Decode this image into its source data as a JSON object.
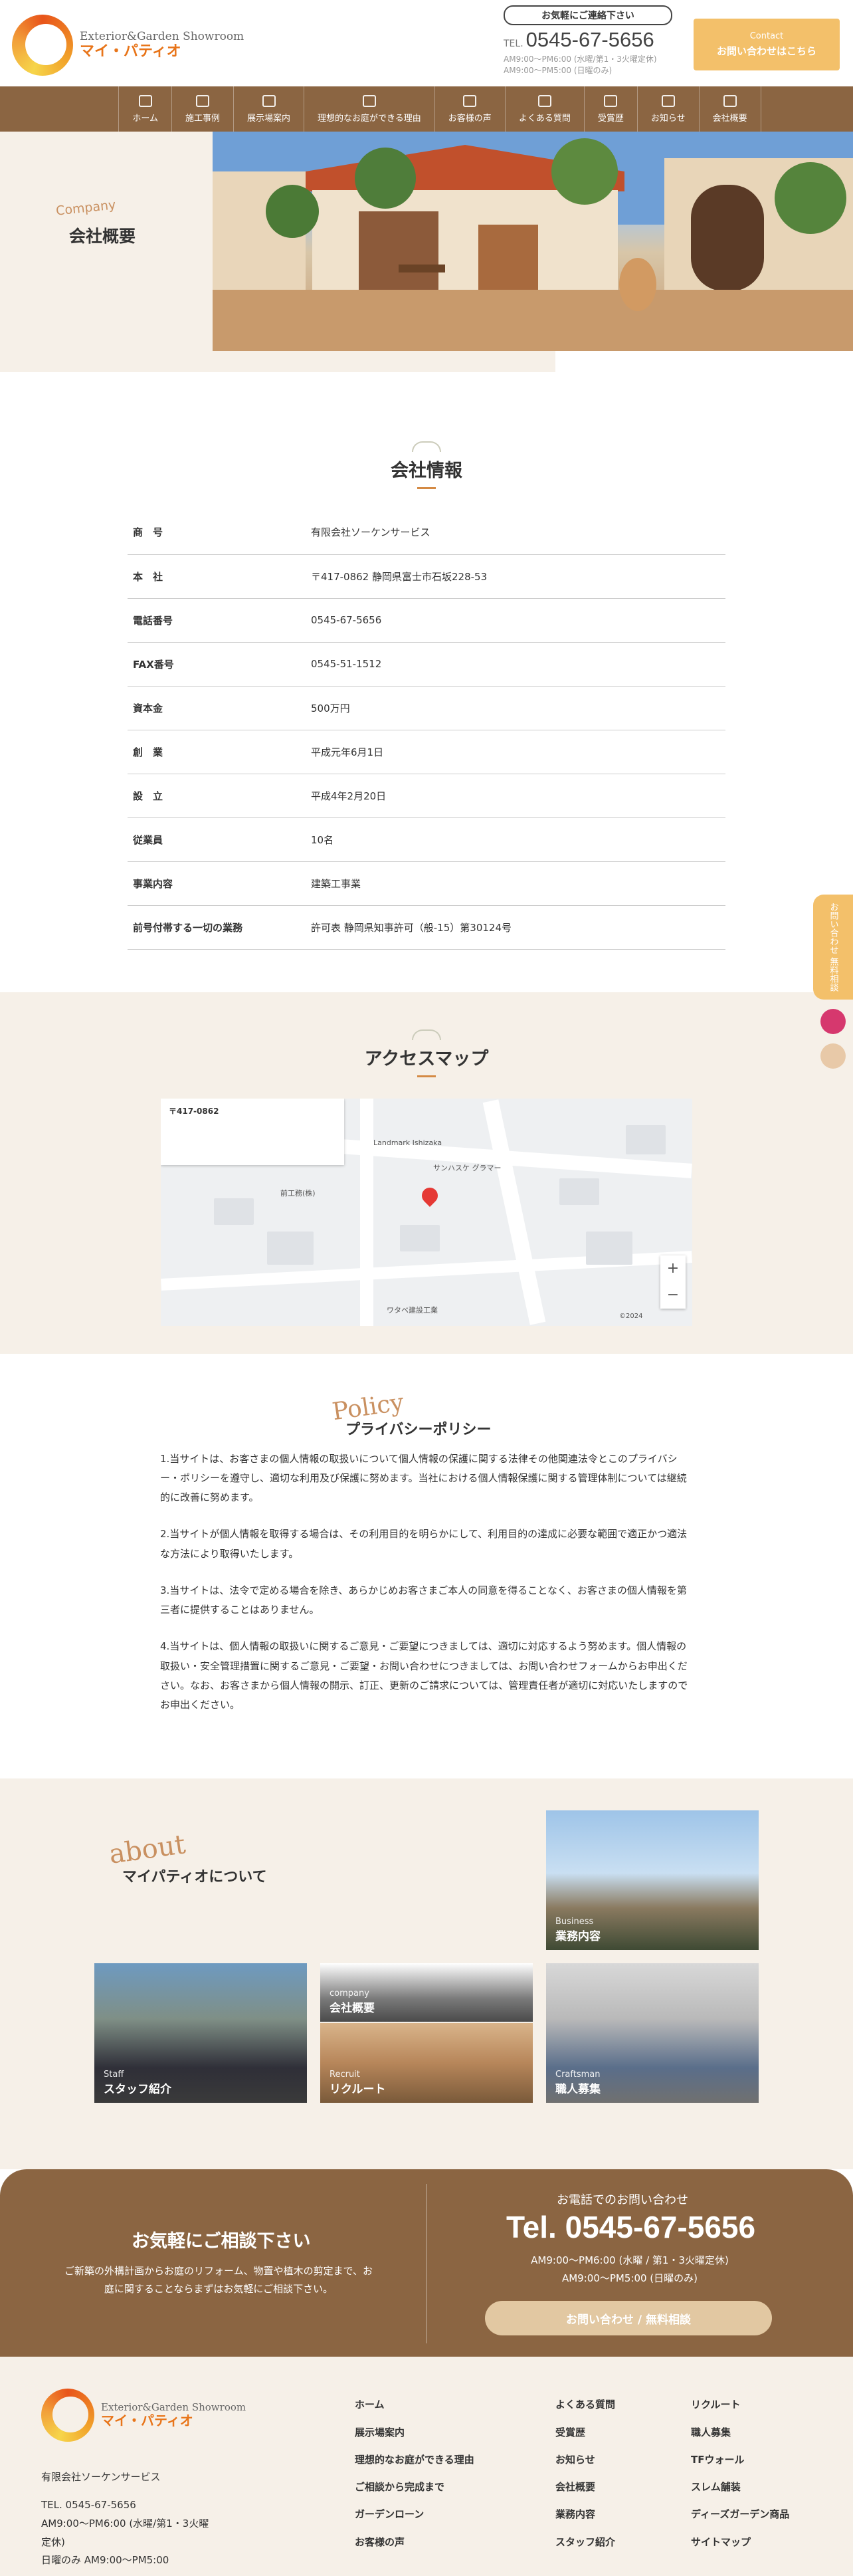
{
  "header": {
    "logo_en": "Exterior&Garden Showroom",
    "logo_ja": "マイ・パティオ",
    "pill": "お気軽にご連絡下さい",
    "tel_label": "TEL.",
    "tel": "0545-67-5656",
    "hours_1": "AM9:00〜PM6:00 (水曜/第1・3火曜定休)",
    "hours_2": "AM9:00〜PM5:00 (日曜のみ)",
    "contact_small": "Contact",
    "contact_main": "お問い合わせはこちら"
  },
  "nav": [
    "ホーム",
    "施工事例",
    "展示場案内",
    "理想的なお庭ができる理由",
    "お客様の声",
    "よくある質問",
    "受賞歴",
    "お知らせ",
    "会社概要"
  ],
  "hero": {
    "title_en": "Company",
    "title": "会社概要"
  },
  "company": {
    "title": "会社情報",
    "rows": [
      {
        "k": "商　号",
        "v": "有限会社ソーケンサービス"
      },
      {
        "k": "本　社",
        "v": "〒417-0862 静岡県富士市石坂228-53"
      },
      {
        "k": "電話番号",
        "v": "0545-67-5656"
      },
      {
        "k": "FAX番号",
        "v": "0545-51-1512"
      },
      {
        "k": "資本金",
        "v": "500万円"
      },
      {
        "k": "創　業",
        "v": "平成元年6月1日"
      },
      {
        "k": "設　立",
        "v": "平成4年2月20日"
      },
      {
        "k": "従業員",
        "v": "10名"
      },
      {
        "k": "事業内容",
        "v": "建築工事業"
      },
      {
        "k": "前号付帯する一切の業務",
        "v": "許可表 静岡県知事許可（般-15）第30124号"
      }
    ]
  },
  "access": {
    "title": "アクセスマップ",
    "card_title": "〒417-0862",
    "map_labels": [
      "Landmark Ishizaka",
      "サンハスケ グラマー",
      "ワタベ建設工業",
      "前工務(株)",
      "©2024"
    ]
  },
  "policy": {
    "title_en": "Policy",
    "title": "プライバシーポリシー",
    "paragraphs": [
      "1.当サイトは、お客さまの個人情報の取扱いについて個人情報の保護に関する法律その他関連法令とこのプライバシー・ポリシーを遵守し、適切な利用及び保護に努めます。当社における個人情報保護に関する管理体制については継続的に改善に努めます。",
      "2.当サイトが個人情報を取得する場合は、その利用目的を明らかにして、利用目的の達成に必要な範囲で適正かつ適法な方法により取得いたします。",
      "3.当サイトは、法令で定める場合を除き、あらかじめお客さまご本人の同意を得ることなく、お客さまの個人情報を第三者に提供することはありません。",
      "4.当サイトは、個人情報の取扱いに関するご意見・ご要望につきましては、適切に対応するよう努めます。個人情報の取扱い・安全管理措置に関するご意見・ご要望・お問い合わせにつきましては、お問い合わせフォームからお申出ください。なお、お客さまから個人情報の開示、訂正、更新のご請求については、管理責任者が適切に対応いたしますのでお申出ください。"
    ]
  },
  "about": {
    "title_en": "about",
    "title": "マイパティオについて",
    "tiles": [
      {
        "en": "company",
        "ja": "会社概要"
      },
      {
        "en": "Business",
        "ja": "業務内容"
      },
      {
        "en": "Staff",
        "ja": "スタッフ紹介"
      },
      {
        "en": "Recruit",
        "ja": "リクルート"
      },
      {
        "en": "Craftsman",
        "ja": "職人募集"
      }
    ]
  },
  "cta": {
    "left_title": "お気軽にご相談下さい",
    "left_text": "ご新築の外構計画からお庭のリフォーム、物置や植木の剪定まで、お庭に関することならまずはお気軽にご相談下さい。",
    "right_label": "お電話でのお問い合わせ",
    "tel": "Tel. 0545-67-5656",
    "hours_1": "AM9:00〜PM6:00 (水曜 / 第1・3火曜定休)",
    "hours_2": "AM9:00〜PM5:00 (日曜のみ)",
    "button": "お問い合わせ / 無料相談"
  },
  "footer": {
    "company": "有限会社ソーケンサービス",
    "tel": "TEL. 0545-67-5656",
    "hours_1": "AM9:00〜PM6:00 (水曜/第1・3火曜定休)",
    "hours_2": "日曜のみ AM9:00〜PM5:00",
    "col1": [
      "ホーム",
      "展示場案内",
      "理想的なお庭ができる理由",
      "ご相談から完成まで",
      "ガーデンローン",
      "お客様の声"
    ],
    "col2": [
      "よくある質問",
      "受賞歴",
      "お知らせ",
      "会社概要",
      "業務内容",
      "スタッフ紹介"
    ],
    "col3": [
      "リクルート",
      "職人募集",
      "TFウォール",
      "スレム舗装",
      "ディーズガーデン商品",
      "サイトマップ"
    ]
  },
  "side": {
    "cta": "お問い合わせ 無料相談"
  },
  "colors": {
    "brown": "#8b6542",
    "beige": "#f6f0e8",
    "orange": "#f3c06a",
    "accent": "#c99060"
  }
}
